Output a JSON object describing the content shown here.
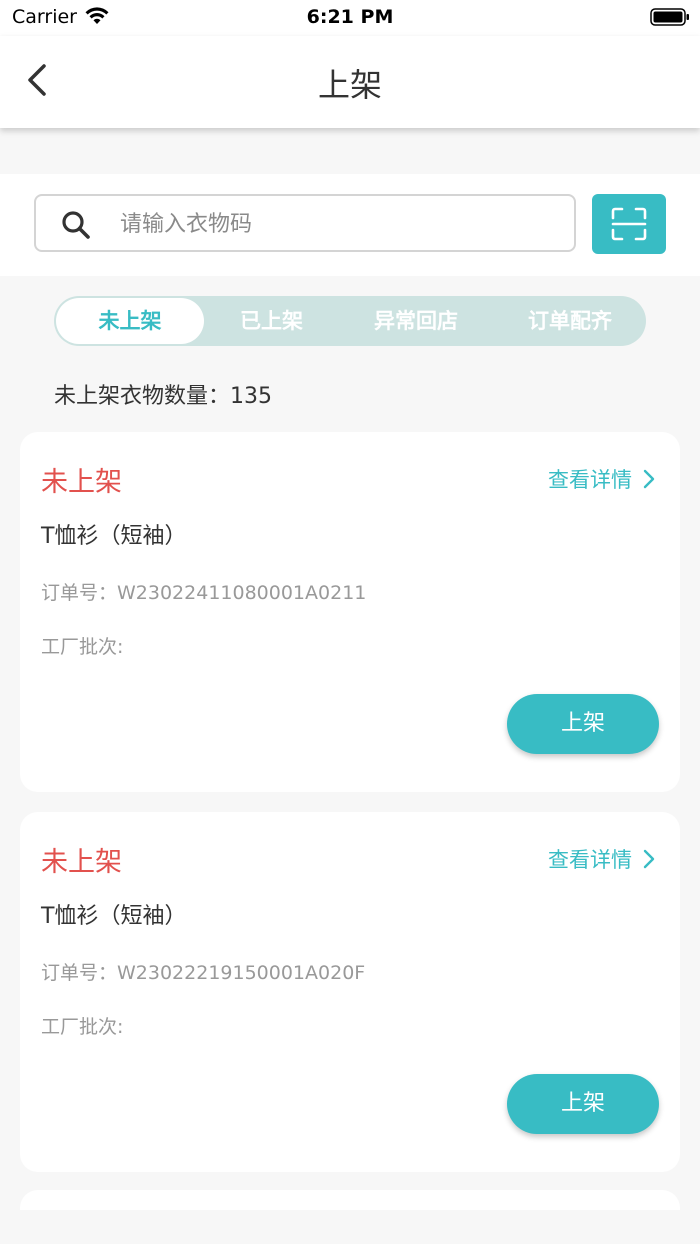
{
  "status_bar": {
    "carrier": "Carrier",
    "time": "6:21 PM"
  },
  "nav": {
    "title": "上架"
  },
  "search": {
    "placeholder": "请输入衣物码",
    "value": ""
  },
  "tabs": [
    {
      "label": "未上架",
      "active": true
    },
    {
      "label": "已上架",
      "active": false
    },
    {
      "label": "异常回店",
      "active": false
    },
    {
      "label": "订单配齐",
      "active": false
    }
  ],
  "count_text": "未上架衣物数量：135",
  "cards": [
    {
      "status": "未上架",
      "detail_link": "查看详情",
      "item": "T恤衫（短袖）",
      "order_no": "订单号：W23022411080001A0211",
      "batch": "工厂批次:",
      "button": "上架"
    },
    {
      "status": "未上架",
      "detail_link": "查看详情",
      "item": "T恤衫（短袖）",
      "order_no": "订单号：W23022219150001A020F",
      "batch": "工厂批次:",
      "button": "上架"
    }
  ],
  "colors": {
    "accent": "#38bcc4",
    "status_red": "#e2514d",
    "tab_bg": "#cde3e1"
  }
}
